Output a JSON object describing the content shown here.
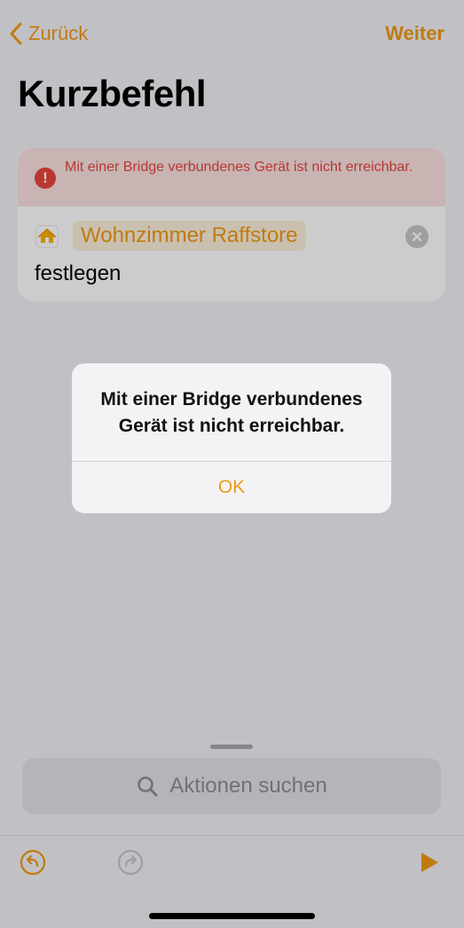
{
  "nav": {
    "back_label": "Zurück",
    "next_label": "Weiter"
  },
  "page_title": "Kurzbefehl",
  "action_card": {
    "error_message": "Mit einer Bridge verbundenes Gerät ist nicht erreichbar.",
    "device_name": "Wohnzimmer Raffstore",
    "action_verb": "festlegen"
  },
  "alert": {
    "message": "Mit einer Bridge verbundenes Gerät ist nicht erreichbar.",
    "ok_label": "OK"
  },
  "bottom_sheet": {
    "search_placeholder": "Aktionen suchen"
  },
  "icons": {
    "back": "chevron-left-icon",
    "error": "exclamation-circle-icon",
    "home": "home-icon",
    "clear": "clear-x-icon",
    "search": "search-icon",
    "undo": "undo-icon",
    "redo": "redo-icon",
    "run": "play-icon"
  },
  "colors": {
    "accent": "#f19a12",
    "error": "#e8453c",
    "error_bg": "#f9e2e0",
    "background": "#f2f2f7"
  }
}
